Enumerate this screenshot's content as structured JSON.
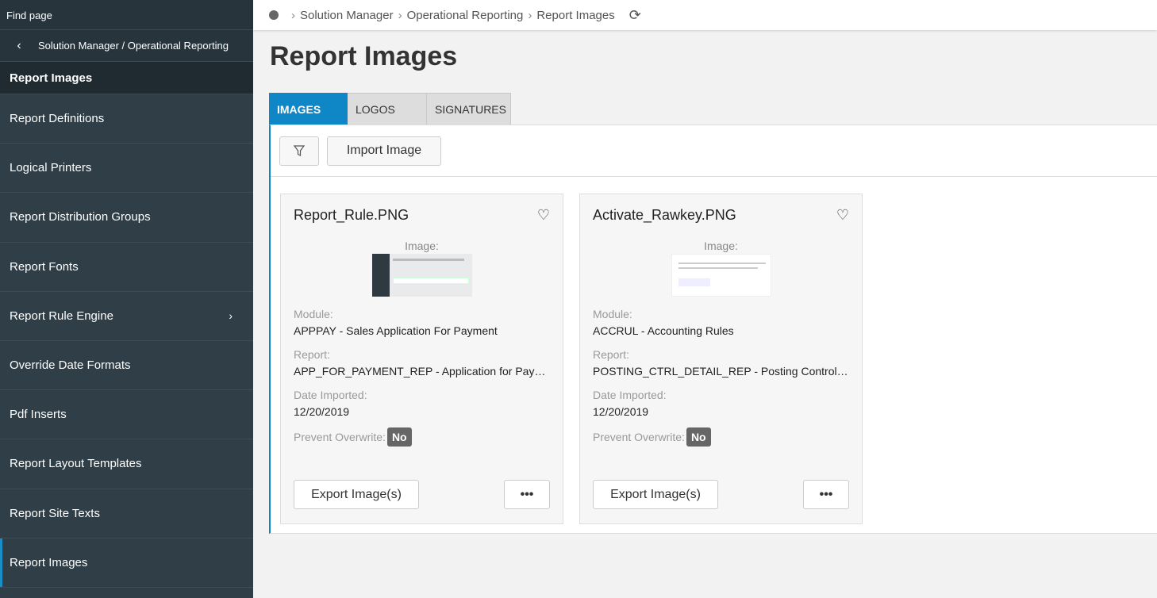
{
  "sidebar": {
    "find_page": "Find page",
    "back_label": "Solution Manager / Operational Reporting",
    "current_title": "Report Images",
    "items": [
      {
        "label": "Report Definitions"
      },
      {
        "label": "Logical Printers"
      },
      {
        "label": "Report Distribution Groups"
      },
      {
        "label": "Report Fonts"
      },
      {
        "label": "Report Rule Engine"
      },
      {
        "label": "Override Date Formats"
      },
      {
        "label": "Pdf Inserts"
      },
      {
        "label": "Report Layout Templates"
      },
      {
        "label": "Report Site Texts"
      },
      {
        "label": "Report Images"
      }
    ]
  },
  "breadcrumb": {
    "items": [
      "Solution Manager",
      "Operational Reporting",
      "Report Images"
    ]
  },
  "page_title": "Report Images",
  "tabs": [
    {
      "label": "IMAGES"
    },
    {
      "label": "LOGOS"
    },
    {
      "label": "SIGNATURES"
    }
  ],
  "toolbar": {
    "import_label": "Import Image"
  },
  "cards": [
    {
      "title": "Report_Rule.PNG",
      "image_label": "Image:",
      "module_label": "Module:",
      "module_value": "APPPAY - Sales Application For Payment",
      "report_label": "Report:",
      "report_value": "APP_FOR_PAYMENT_REP - Application for Payment",
      "date_label": "Date Imported:",
      "date_value": "12/20/2019",
      "overwrite_label": "Prevent Overwrite:",
      "overwrite_value": "No",
      "export_label": "Export Image(s)",
      "more_label": "•••"
    },
    {
      "title": "Activate_Rawkey.PNG",
      "image_label": "Image:",
      "module_label": "Module:",
      "module_value": "ACCRUL - Accounting Rules",
      "report_label": "Report:",
      "report_value": "POSTING_CTRL_DETAIL_REP - Posting Control Report",
      "date_label": "Date Imported:",
      "date_value": "12/20/2019",
      "overwrite_label": "Prevent Overwrite:",
      "overwrite_value": "No",
      "export_label": "Export Image(s)",
      "more_label": "•••"
    }
  ],
  "colors": {
    "accent": "#0f86c6",
    "sidebar_bg": "#2f3e47"
  }
}
